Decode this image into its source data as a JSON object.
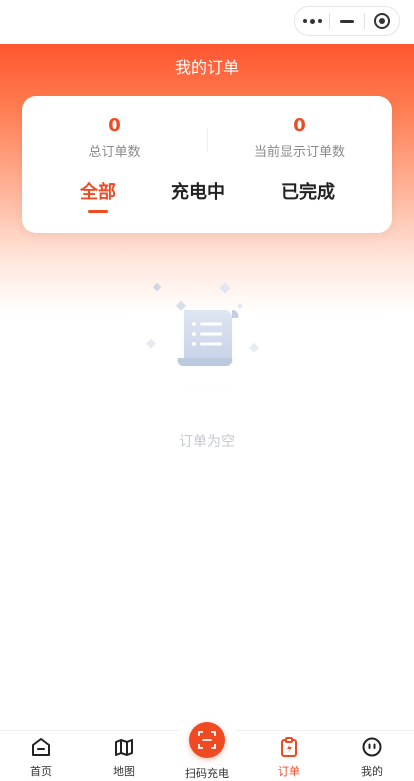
{
  "page": {
    "title": "我的订单"
  },
  "summary": {
    "total_orders": {
      "value": "0",
      "label": "总订单数"
    },
    "shown_orders": {
      "value": "0",
      "label": "当前显示订单数"
    }
  },
  "filter_tabs": [
    {
      "label": "全部",
      "active": true
    },
    {
      "label": "充电中",
      "active": false
    },
    {
      "label": "已完成",
      "active": false
    }
  ],
  "empty_state": {
    "text": "订单为空",
    "icon": "document-icon"
  },
  "tabbar": {
    "items": [
      {
        "label": "首页",
        "icon": "home-icon",
        "active": false
      },
      {
        "label": "地图",
        "icon": "map-icon",
        "active": false
      },
      {
        "label": "扫码充电",
        "icon": "scan-icon",
        "active": false
      },
      {
        "label": "订单",
        "icon": "order-charge-icon",
        "active": true
      },
      {
        "label": "我的",
        "icon": "profile-icon",
        "active": false
      }
    ]
  },
  "colors": {
    "accent": "#f04a22",
    "header_top": "#ff5630",
    "empty_text": "#c4c9d2"
  }
}
